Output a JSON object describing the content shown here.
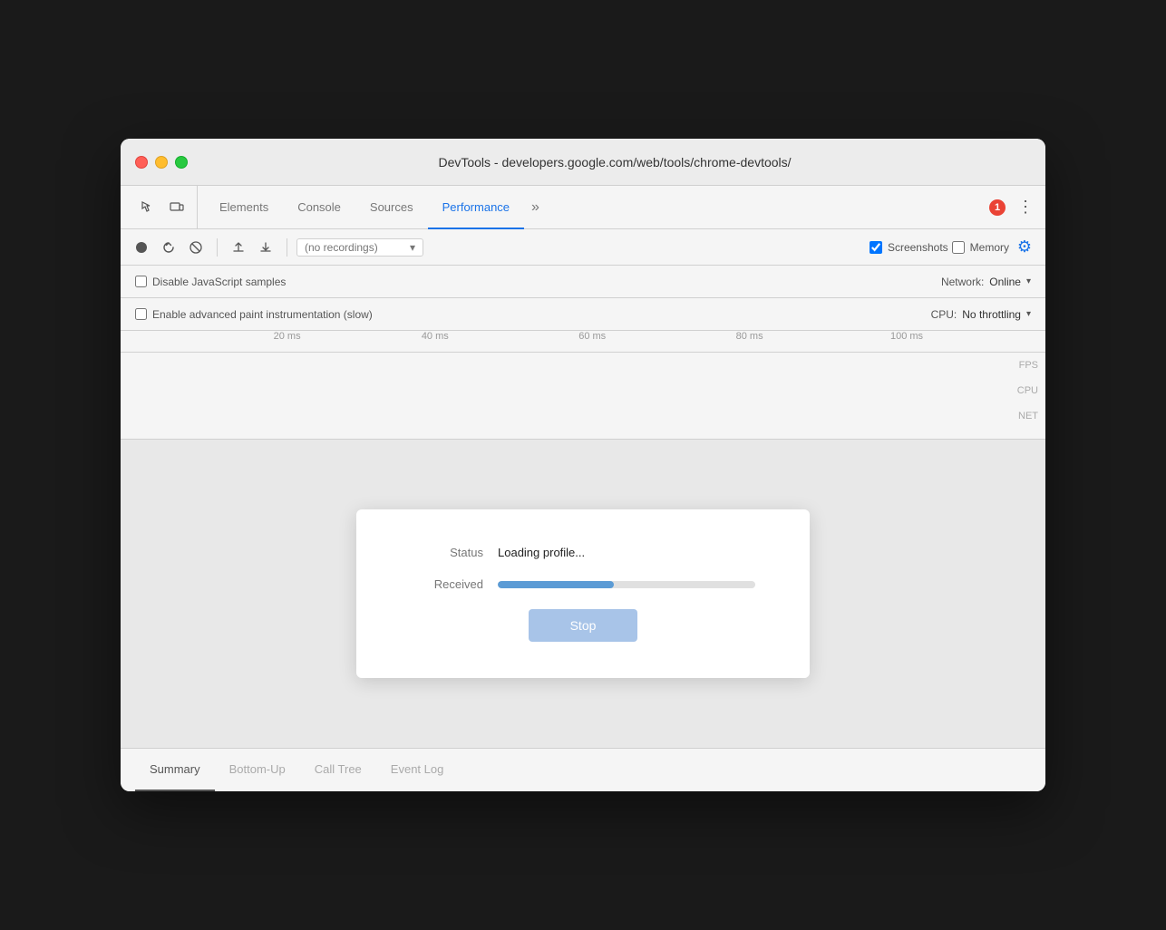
{
  "window": {
    "title": "DevTools - developers.google.com/web/tools/chrome-devtools/"
  },
  "tabs": {
    "items": [
      {
        "id": "elements",
        "label": "Elements",
        "active": false
      },
      {
        "id": "console",
        "label": "Console",
        "active": false
      },
      {
        "id": "sources",
        "label": "Sources",
        "active": false
      },
      {
        "id": "performance",
        "label": "Performance",
        "active": true
      }
    ],
    "more_label": "»",
    "error_count": "1"
  },
  "toolbar": {
    "recordings_placeholder": "(no recordings)",
    "screenshots_label": "Screenshots",
    "memory_label": "Memory"
  },
  "settings": {
    "disable_js_label": "Disable JavaScript samples",
    "enable_paint_label": "Enable advanced paint instrumentation (slow)",
    "network_label": "Network:",
    "network_value": "Online",
    "cpu_label": "CPU:",
    "cpu_value": "No throttling"
  },
  "timeline": {
    "time_labels": [
      "20 ms",
      "40 ms",
      "60 ms",
      "80 ms",
      "100 ms"
    ],
    "tracks": [
      "FPS",
      "CPU",
      "NET"
    ]
  },
  "loading_dialog": {
    "status_label": "Status",
    "status_value": "Loading profile...",
    "received_label": "Received",
    "progress_percent": 45,
    "stop_button": "Stop"
  },
  "bottom_tabs": {
    "items": [
      {
        "id": "summary",
        "label": "Summary",
        "active": true
      },
      {
        "id": "bottom-up",
        "label": "Bottom-Up",
        "active": false
      },
      {
        "id": "call-tree",
        "label": "Call Tree",
        "active": false
      },
      {
        "id": "event-log",
        "label": "Event Log",
        "active": false
      }
    ]
  }
}
